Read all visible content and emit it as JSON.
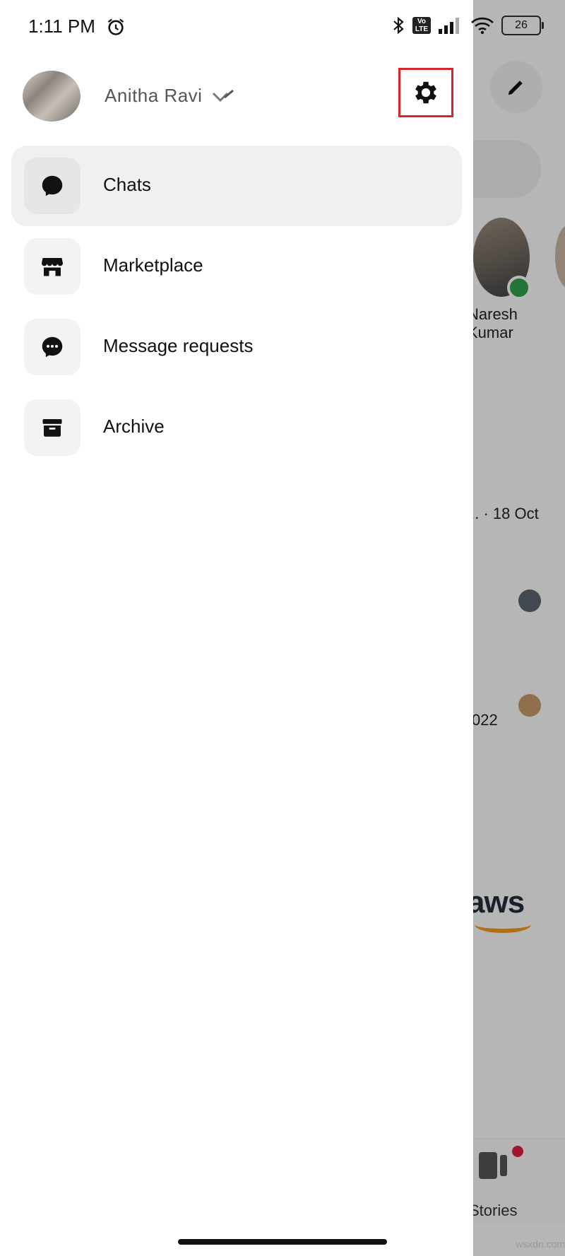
{
  "status_bar": {
    "time": "1:11 PM",
    "network_badge": "Vo LTE",
    "battery": "26",
    "icons": [
      "alarm-icon",
      "bluetooth-icon",
      "volte-icon",
      "signal-icon",
      "wifi-icon",
      "battery-icon"
    ]
  },
  "drawer": {
    "profile_name": "Anitha Ravi",
    "settings_icon": "gear-icon",
    "settings_highlight_color": "#d3262e",
    "menu": [
      {
        "label": "Chats",
        "icon": "chat-bubble-icon",
        "active": true
      },
      {
        "label": "Marketplace",
        "icon": "storefront-icon",
        "active": false
      },
      {
        "label": "Message requests",
        "icon": "message-requests-icon",
        "active": false
      },
      {
        "label": "Archive",
        "icon": "archive-icon",
        "active": false
      }
    ]
  },
  "background": {
    "story_name_line1": "Naresh",
    "story_name_line2": "Kumar",
    "chat_date": "... · 18 Oct",
    "chat_year": "022",
    "aws_text": "aws",
    "stories_label": "Stories",
    "online_color": "#31a24c",
    "notification_color": "#e41e3f"
  },
  "watermark": "wsxdn.com"
}
